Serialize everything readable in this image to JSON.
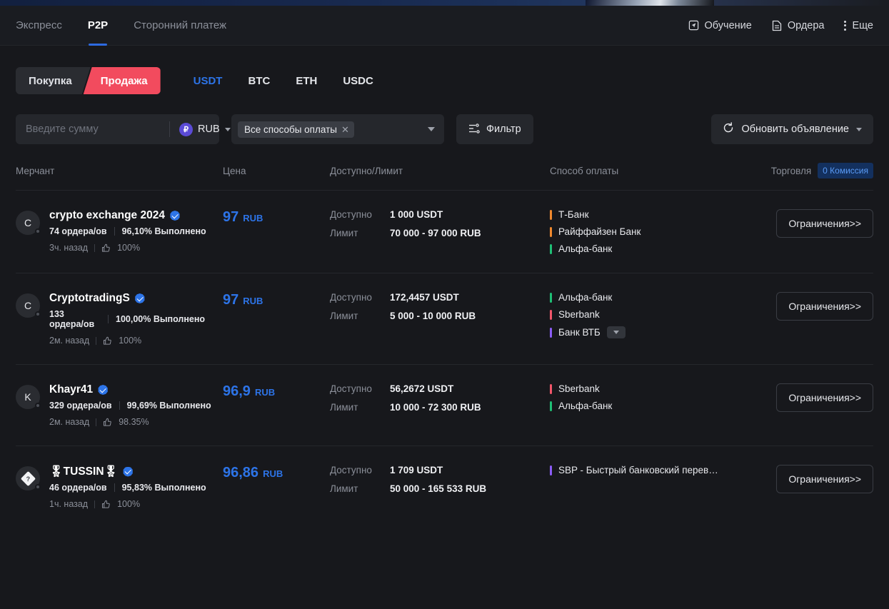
{
  "header": {
    "nav": [
      {
        "label": "Экспресс",
        "active": false
      },
      {
        "label": "P2P",
        "active": true
      },
      {
        "label": "Сторонний платеж",
        "active": false
      }
    ],
    "actions": [
      {
        "label": "Обучение",
        "icon": "education-icon"
      },
      {
        "label": "Ордера",
        "icon": "document-icon"
      },
      {
        "label": "Еще",
        "icon": "more-vertical-icon"
      }
    ]
  },
  "trade_tabs": {
    "buy_label": "Покупка",
    "sell_label": "Продажа",
    "active": "sell",
    "sell_color": "#f24b5e"
  },
  "coins": [
    {
      "label": "USDT",
      "active": true
    },
    {
      "label": "BTC",
      "active": false
    },
    {
      "label": "ETH",
      "active": false
    },
    {
      "label": "USDC",
      "active": false
    }
  ],
  "filters": {
    "amount_placeholder": "Введите сумму",
    "amount_value": "",
    "currency": "RUB",
    "currency_symbol": "₽",
    "payment_chip": "Все способы оплаты",
    "filter_label": "Фильтр",
    "refresh_label": "Обновить объявление"
  },
  "table": {
    "columns": {
      "merchant": "Мерчант",
      "price": "Цена",
      "available": "Доступно/Лимит",
      "payment": "Способ оплаты",
      "trade": "Торговля"
    },
    "fee_badge": "0 Комиссия",
    "labels": {
      "available": "Доступно",
      "limit": "Лимит"
    },
    "rows": [
      {
        "avatar_letter": "C",
        "avatar_type": "letter",
        "name": "crypto exchange 2024",
        "verified": true,
        "orders": "74 ордера/ов",
        "completion": "96,10% Выполнено",
        "last_seen": "3ч. назад",
        "rating": "100%",
        "price": "97",
        "price_unit": "RUB",
        "available": "1 000 USDT",
        "limit": "70 000 - 97 000 RUB",
        "payments": [
          {
            "name": "Т-Банк",
            "color": "#f0892e"
          },
          {
            "name": "Райффайзен Банк",
            "color": "#f0892e"
          },
          {
            "name": "Альфа-банк",
            "color": "#1fbf75"
          }
        ],
        "has_more_payments": false,
        "action": "Ограничения>>"
      },
      {
        "avatar_letter": "C",
        "avatar_type": "letter",
        "name": "CryptotradingS",
        "verified": true,
        "orders": "133 ордера/ов",
        "completion": "100,00% Выполнено",
        "last_seen": "2м. назад",
        "rating": "100%",
        "price": "97",
        "price_unit": "RUB",
        "available": "172,4457 USDT",
        "limit": "5 000 - 10 000 RUB",
        "payments": [
          {
            "name": "Альфа-банк",
            "color": "#1fbf75"
          },
          {
            "name": "Sberbank",
            "color": "#f2566a"
          },
          {
            "name": "Банк ВТБ",
            "color": "#8b5cf6"
          }
        ],
        "has_more_payments": true,
        "action": "Ограничения>>"
      },
      {
        "avatar_letter": "K",
        "avatar_type": "letter",
        "name": "Khayr41",
        "verified": true,
        "orders": "329 ордера/ов",
        "completion": "99,69% Выполнено",
        "last_seen": "2м. назад",
        "rating": "98.35%",
        "price": "96,9",
        "price_unit": "RUB",
        "available": "56,2672 USDT",
        "limit": "10 000 - 72 300 RUB",
        "payments": [
          {
            "name": "Sberbank",
            "color": "#f2566a"
          },
          {
            "name": "Альфа-банк",
            "color": "#1fbf75"
          }
        ],
        "has_more_payments": false,
        "action": "Ограничения>>"
      },
      {
        "avatar_letter": "?",
        "avatar_type": "diamond",
        "name": "🎖TUSSIN🎖",
        "verified": true,
        "orders": "46 ордера/ов",
        "completion": "95,83% Выполнено",
        "last_seen": "1ч. назад",
        "rating": "100%",
        "price": "96,86",
        "price_unit": "RUB",
        "available": "1 709 USDT",
        "limit": "50 000 - 165 533 RUB",
        "payments": [
          {
            "name": "SBP - Быстрый банковский перев…",
            "color": "#8b5cf6"
          }
        ],
        "has_more_payments": false,
        "action": "Ограничения>>"
      }
    ]
  }
}
